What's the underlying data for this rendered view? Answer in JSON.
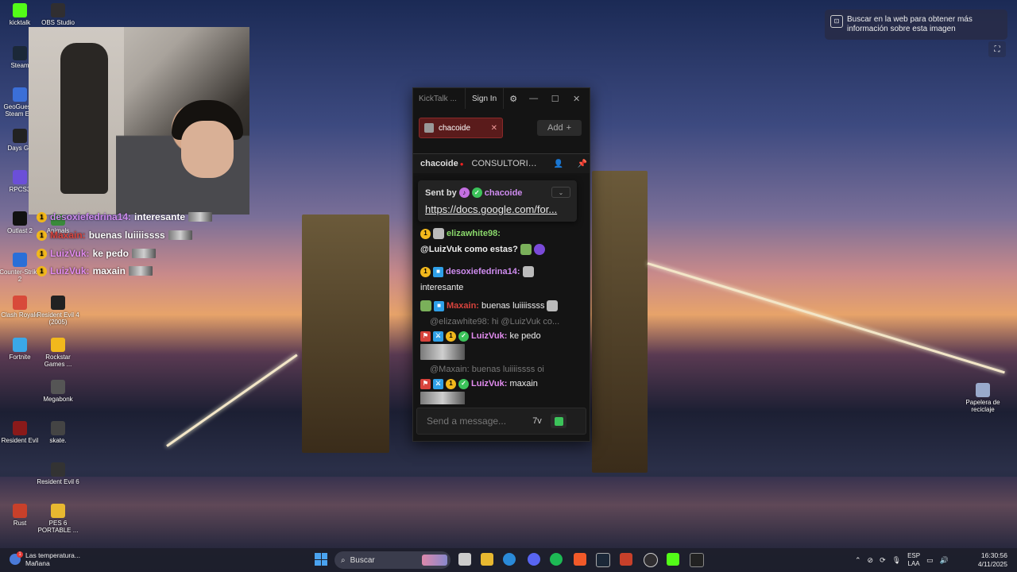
{
  "desktop": {
    "icons": [
      {
        "label": "kicktalk",
        "icon": "kicktalk-icon",
        "color": "#53fc18"
      },
      {
        "label": "OBS Studio",
        "icon": "obs-icon",
        "color": "#302e31"
      },
      {
        "label": "Steam",
        "icon": "steam-icon",
        "color": "#1b2838"
      },
      {
        "label": "GeoGuessr Steam E...",
        "icon": "geoguessr-icon",
        "color": "#3b6fd8"
      },
      {
        "label": "Days Go",
        "icon": "days-gone-icon",
        "color": "#222"
      },
      {
        "label": "RPCS3",
        "icon": "rpcs3-icon",
        "color": "#6b4fd8"
      },
      {
        "label": "Outlast 2",
        "icon": "outlast-icon",
        "color": "#111"
      },
      {
        "label": "Animals",
        "icon": "animals-icon",
        "color": "#3a8a3a"
      },
      {
        "label": "Counter-Strike 2",
        "icon": "cs2-icon",
        "color": "#2a6fd8"
      },
      {
        "label": "Clash Royale",
        "icon": "clash-royale-icon",
        "color": "#d84a3a"
      },
      {
        "label": "Resident Evil 4 (2005)",
        "icon": "re4-icon",
        "color": "#222"
      },
      {
        "label": "Fortnite",
        "icon": "fortnite-icon",
        "color": "#3aa8e8"
      },
      {
        "label": "Rockstar Games ...",
        "icon": "rockstar-icon",
        "color": "#f2b81c"
      },
      {
        "label": "Megabonk",
        "icon": "megabonk-icon",
        "color": "#555"
      },
      {
        "label": "Resident Evil",
        "icon": "re-icon",
        "color": "#8a1a1a"
      },
      {
        "label": "skate.",
        "icon": "skate-icon",
        "color": "#444"
      },
      {
        "label": "Resident Evil 6",
        "icon": "re6-icon",
        "color": "#333"
      },
      {
        "label": "Rust",
        "icon": "rust-icon",
        "color": "#c8402a"
      },
      {
        "label": "PES 6 PORTABLE ...",
        "icon": "folder-icon",
        "color": "#e8b830"
      },
      {
        "label": "Papelera de reciclaje",
        "icon": "recycle-bin-icon",
        "color": "#9ac"
      }
    ]
  },
  "overlay_chat": [
    {
      "user": "desoxiefedrina14:",
      "user_color": "#cf8cf0",
      "text": "interesante"
    },
    {
      "user": "Maxain:",
      "user_color": "#d8433c",
      "text": "buenas luiiiissss"
    },
    {
      "user": "LuizVuk:",
      "user_color": "#e38cf0",
      "text": "ke pedo"
    },
    {
      "user": "LuizVuk:",
      "user_color": "#e38cf0",
      "text": "maxain"
    }
  ],
  "kicktalk": {
    "title": "KickTalk ...",
    "sign_in": "Sign In",
    "tab_channel": "chacoide",
    "add_label": "Add",
    "header_channel": "chacoide",
    "header_stream": "CONSULTORIO...",
    "pinned": {
      "sent_by": "Sent by",
      "user": "chacoide",
      "link": "https://docs.google.com/for..."
    },
    "messages": [
      {
        "user": "elizawhite98:",
        "user_color": "#8ad86b",
        "text": ""
      },
      {
        "user": "",
        "user_color": "#fff",
        "text": "@LuizVuk como estas?"
      },
      {
        "user": "desoxiefedrina14:",
        "user_color": "#cf8cf0",
        "text": "interesante"
      },
      {
        "user": "Maxain:",
        "user_color": "#d8433c",
        "text": "buenas luiiiissss"
      },
      {
        "reply": "@elizawhite98: hi @LuizVuk co..."
      },
      {
        "user": "LuizVuk:",
        "user_color": "#e38cf0",
        "text": "ke pedo"
      },
      {
        "reply": "@Maxain: buenas luiiiissss oi"
      },
      {
        "user": "LuizVuk:",
        "user_color": "#e38cf0",
        "text": "maxain"
      }
    ],
    "input_placeholder": "Send a message..."
  },
  "lens": {
    "text": "Buscar en la web para obtener más información sobre esta imagen"
  },
  "taskbar": {
    "weather_title": "Las temperatura...",
    "weather_sub": "Mañana",
    "search_placeholder": "Buscar",
    "lang_top": "ESP",
    "lang_bottom": "LAA",
    "time": "16:30:56",
    "date": "4/11/2025"
  }
}
